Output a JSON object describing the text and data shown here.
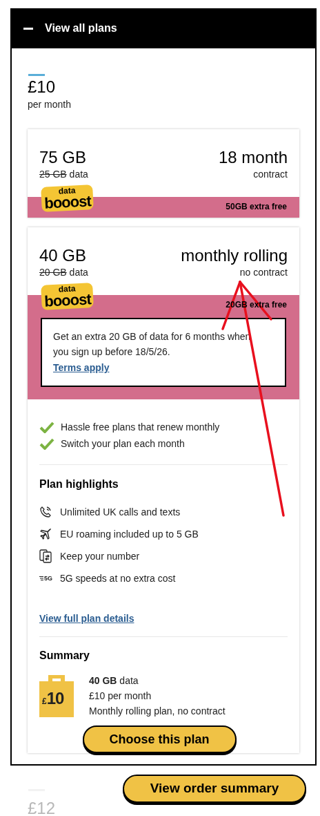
{
  "header": {
    "title": "View all plans",
    "expanded": true
  },
  "price": {
    "amount": "£10",
    "period": "per month"
  },
  "plans": [
    {
      "data": "75 GB",
      "old_data": "25 GB",
      "data_suffix": "data",
      "term": "18 month",
      "term_note": "contract",
      "logo_top": "data",
      "logo_bottom": "booost",
      "extra": "50GB extra free",
      "expanded": false
    },
    {
      "data": "40 GB",
      "old_data": "20 GB",
      "data_suffix": "data",
      "term": "monthly rolling",
      "term_note": "no contract",
      "logo_top": "data",
      "logo_bottom": "booost",
      "extra": "20GB extra free",
      "expanded": true,
      "offer": {
        "text": "Get an extra 20 GB of data for 6 months when you sign up before 18/5/26.",
        "link": "Terms apply"
      },
      "benefits": [
        "Hassle free plans that renew monthly",
        "Switch your plan each month"
      ],
      "highlights_title": "Plan highlights",
      "highlights": [
        {
          "kind": "calls",
          "text": "Unlimited UK calls and texts"
        },
        {
          "kind": "roaming",
          "text": "EU roaming included up to 5 GB"
        },
        {
          "kind": "number",
          "text": "Keep your number"
        },
        {
          "kind": "fiveg",
          "icon_label": "5G",
          "text": "5G speeds at no extra cost"
        }
      ],
      "details_link": "View full plan details",
      "summary_title": "Summary",
      "summary_badge": {
        "currency": "£",
        "amount": "10"
      },
      "summary_lines": [
        "**40 GB** data",
        "£10 per month",
        "Monthly rolling plan, no contract"
      ],
      "choose_button": "Choose this plan"
    }
  ],
  "next_price": "£12",
  "order_button": "View order summary"
}
